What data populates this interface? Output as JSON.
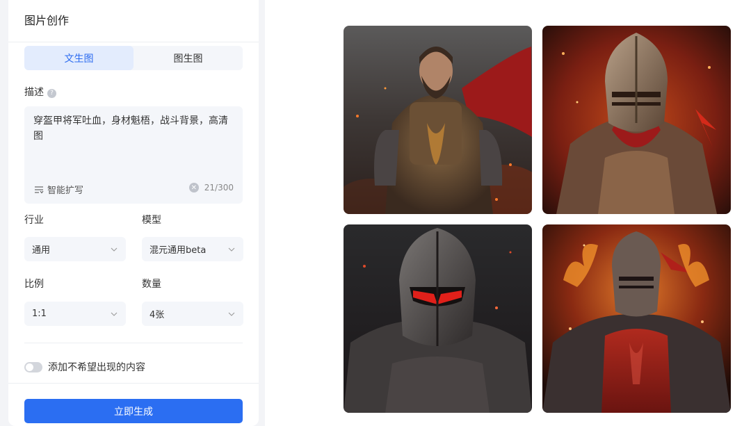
{
  "panel": {
    "title": "图片创作",
    "tabs": [
      {
        "label": "文生图",
        "active": true
      },
      {
        "label": "图生图",
        "active": false
      }
    ],
    "description": {
      "label": "描述",
      "value": "穿盔甲将军吐血，身材魁梧，战斗背景，高清图",
      "expand_label": "智能扩写",
      "counter": "21/300"
    },
    "industry": {
      "label": "行业",
      "value": "通用"
    },
    "model": {
      "label": "模型",
      "value": "混元通用beta"
    },
    "ratio": {
      "label": "比例",
      "value": "1:1"
    },
    "quantity": {
      "label": "数量",
      "value": "4张"
    },
    "negative_toggle": {
      "label": "添加不希望出现的内容",
      "on": false
    },
    "generate_label": "立即生成"
  },
  "results": {
    "images": [
      {
        "name": "bearded-warrior-in-armor"
      },
      {
        "name": "knight-in-helmet-with-fire"
      },
      {
        "name": "dark-knight-red-visor"
      },
      {
        "name": "red-armored-knight-flames"
      }
    ]
  },
  "colors": {
    "accent": "#2b6ef2",
    "active_tab_bg": "#e3ecfd",
    "active_tab_text": "#2c6bf0",
    "field_bg": "#f4f6fa"
  }
}
